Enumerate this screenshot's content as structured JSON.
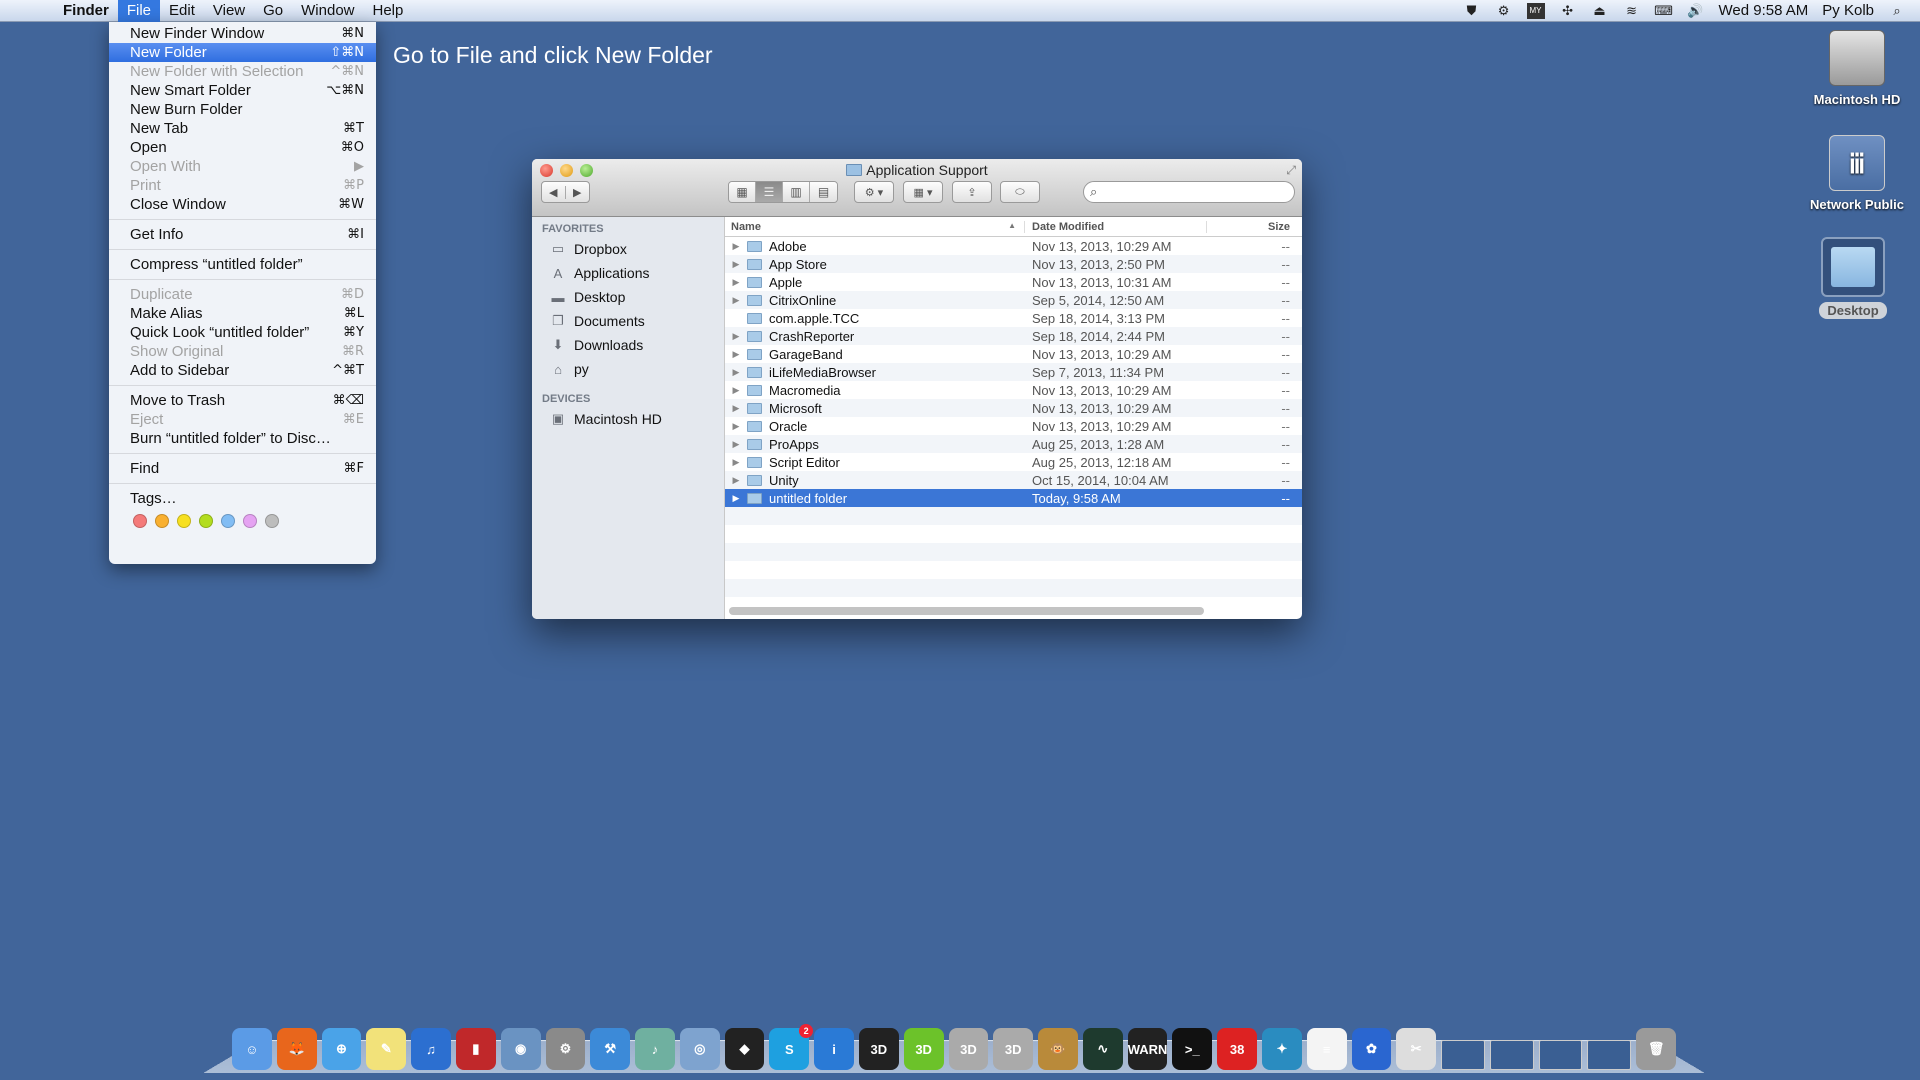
{
  "menubar": {
    "apple_icon": "apple-logo-icon",
    "app_name": "Finder",
    "menus": [
      "File",
      "Edit",
      "View",
      "Go",
      "Window",
      "Help"
    ],
    "active_menu": "File",
    "status_icons": [
      "vpn-shield-icon",
      "gear-badge-icon",
      "mypc-icon",
      "fan-icon",
      "eject-icon",
      "wifi-icon",
      "keyboard-icon",
      "volume-icon"
    ],
    "clock": "Wed 9:58 AM",
    "user": "Py Kolb",
    "spotlight_icon": "search-icon"
  },
  "file_menu": {
    "groups": [
      [
        {
          "label": "New Finder Window",
          "shortcut": "⌘N",
          "enabled": true
        },
        {
          "label": "New Folder",
          "shortcut": "⇧⌘N",
          "enabled": true,
          "highlighted": true
        },
        {
          "label": "New Folder with Selection",
          "shortcut": "^⌘N",
          "enabled": false
        },
        {
          "label": "New Smart Folder",
          "shortcut": "⌥⌘N",
          "enabled": true
        },
        {
          "label": "New Burn Folder",
          "shortcut": "",
          "enabled": true
        },
        {
          "label": "New Tab",
          "shortcut": "⌘T",
          "enabled": true
        },
        {
          "label": "Open",
          "shortcut": "⌘O",
          "enabled": true
        },
        {
          "label": "Open With",
          "shortcut": "▶",
          "enabled": false
        },
        {
          "label": "Print",
          "shortcut": "⌘P",
          "enabled": false
        },
        {
          "label": "Close Window",
          "shortcut": "⌘W",
          "enabled": true
        }
      ],
      [
        {
          "label": "Get Info",
          "shortcut": "⌘I",
          "enabled": true
        }
      ],
      [
        {
          "label": "Compress “untitled folder”",
          "shortcut": "",
          "enabled": true
        }
      ],
      [
        {
          "label": "Duplicate",
          "shortcut": "⌘D",
          "enabled": false
        },
        {
          "label": "Make Alias",
          "shortcut": "⌘L",
          "enabled": true
        },
        {
          "label": "Quick Look “untitled folder”",
          "shortcut": "⌘Y",
          "enabled": true
        },
        {
          "label": "Show Original",
          "shortcut": "⌘R",
          "enabled": false
        },
        {
          "label": "Add to Sidebar",
          "shortcut": "^⌘T",
          "enabled": true
        }
      ],
      [
        {
          "label": "Move to Trash",
          "shortcut": "⌘⌫",
          "enabled": true
        },
        {
          "label": "Eject",
          "shortcut": "⌘E",
          "enabled": false
        },
        {
          "label": "Burn “untitled folder” to Disc…",
          "shortcut": "",
          "enabled": true
        }
      ],
      [
        {
          "label": "Find",
          "shortcut": "⌘F",
          "enabled": true
        }
      ],
      [
        {
          "label": "Tags…",
          "shortcut": "",
          "enabled": true
        }
      ]
    ],
    "tag_colors": [
      "#f47a7a",
      "#f9b031",
      "#f7e021",
      "#b3dd1f",
      "#82bdf4",
      "#e5a3f2",
      "#bdbdbd"
    ]
  },
  "instruction": "Go to File and click New Folder",
  "finder": {
    "title": "Application Support",
    "toolbar": {
      "nav": [
        "◀",
        "▶"
      ],
      "view_modes": [
        "icon-view",
        "list-view",
        "column-view",
        "coverflow-view"
      ],
      "active_view": 1,
      "action_label": "⚙ ▾",
      "arrange_label": "▦ ▾",
      "share_label": "⇪",
      "tags_label": "⬭",
      "search_placeholder": ""
    },
    "sidebar": {
      "favorites_header": "FAVORITES",
      "favorites": [
        {
          "label": "Dropbox",
          "icon": "folder-icon"
        },
        {
          "label": "Applications",
          "icon": "applications-icon"
        },
        {
          "label": "Desktop",
          "icon": "desktop-icon"
        },
        {
          "label": "Documents",
          "icon": "documents-icon"
        },
        {
          "label": "Downloads",
          "icon": "downloads-icon"
        },
        {
          "label": "py",
          "icon": "home-icon"
        }
      ],
      "devices_header": "DEVICES",
      "devices": [
        {
          "label": "Macintosh HD",
          "icon": "hard-drive-icon"
        }
      ]
    },
    "columns": {
      "name": "Name",
      "date": "Date Modified",
      "size": "Size",
      "sort_indicator": "▲"
    },
    "rows": [
      {
        "name": "Adobe",
        "date": "Nov 13, 2013, 10:29 AM",
        "size": "--",
        "expandable": true
      },
      {
        "name": "App Store",
        "date": "Nov 13, 2013, 2:50 PM",
        "size": "--",
        "expandable": true
      },
      {
        "name": "Apple",
        "date": "Nov 13, 2013, 10:31 AM",
        "size": "--",
        "expandable": true
      },
      {
        "name": "CitrixOnline",
        "date": "Sep 5, 2014, 12:50 AM",
        "size": "--",
        "expandable": true
      },
      {
        "name": "com.apple.TCC",
        "date": "Sep 18, 2014, 3:13 PM",
        "size": "--",
        "expandable": false
      },
      {
        "name": "CrashReporter",
        "date": "Sep 18, 2014, 2:44 PM",
        "size": "--",
        "expandable": true
      },
      {
        "name": "GarageBand",
        "date": "Nov 13, 2013, 10:29 AM",
        "size": "--",
        "expandable": true
      },
      {
        "name": "iLifeMediaBrowser",
        "date": "Sep 7, 2013, 11:34 PM",
        "size": "--",
        "expandable": true
      },
      {
        "name": "Macromedia",
        "date": "Nov 13, 2013, 10:29 AM",
        "size": "--",
        "expandable": true
      },
      {
        "name": "Microsoft",
        "date": "Nov 13, 2013, 10:29 AM",
        "size": "--",
        "expandable": true
      },
      {
        "name": "Oracle",
        "date": "Nov 13, 2013, 10:29 AM",
        "size": "--",
        "expandable": true
      },
      {
        "name": "ProApps",
        "date": "Aug 25, 2013, 1:28 AM",
        "size": "--",
        "expandable": true
      },
      {
        "name": "Script Editor",
        "date": "Aug 25, 2013, 12:18 AM",
        "size": "--",
        "expandable": true
      },
      {
        "name": "Unity",
        "date": "Oct 15, 2014, 10:04 AM",
        "size": "--",
        "expandable": true
      },
      {
        "name": "untitled folder",
        "date": "Today, 9:58 AM",
        "size": "--",
        "expandable": true,
        "selected": true
      }
    ]
  },
  "desktop_icons": [
    {
      "label": "Macintosh HD",
      "icon": "hard-drive-icon"
    },
    {
      "label": "Network Public",
      "icon": "network-drive-icon"
    },
    {
      "label": "Desktop",
      "icon": "folder-icon",
      "selected": true
    }
  ],
  "dock": [
    {
      "name": "finder",
      "glyph": "☺",
      "color": "#5b9be6"
    },
    {
      "name": "firefox",
      "glyph": "🦊",
      "color": "#e8661c"
    },
    {
      "name": "safari",
      "glyph": "⊕",
      "color": "#4aa3e8"
    },
    {
      "name": "stickies",
      "glyph": "✎",
      "color": "#f2e27a"
    },
    {
      "name": "itunes",
      "glyph": "♫",
      "color": "#2c6fd0"
    },
    {
      "name": "photo-booth",
      "glyph": "▮",
      "color": "#c0282a"
    },
    {
      "name": "iphoto",
      "glyph": "◉",
      "color": "#6a93c2"
    },
    {
      "name": "system-preferences",
      "glyph": "⚙",
      "color": "#8a8a8a"
    },
    {
      "name": "xcode",
      "glyph": "⚒",
      "color": "#3c8ad8"
    },
    {
      "name": "midi-app",
      "glyph": "♪",
      "color": "#6fb0a0"
    },
    {
      "name": "unity-remote",
      "glyph": "◎",
      "color": "#7ea3cf"
    },
    {
      "name": "unity",
      "glyph": "◆",
      "color": "#222"
    },
    {
      "name": "skype",
      "glyph": "S",
      "color": "#1ea0e0",
      "badge": "2"
    },
    {
      "name": "info",
      "glyph": "i",
      "color": "#2a7ad6"
    },
    {
      "name": "3d-app",
      "glyph": "3D",
      "color": "#222"
    },
    {
      "name": "3d-app-5",
      "glyph": "3D",
      "color": "#6cc22a"
    },
    {
      "name": "3d-app-6",
      "glyph": "3D",
      "color": "#aaa"
    },
    {
      "name": "3d-app-7",
      "glyph": "3D",
      "color": "#aaa"
    },
    {
      "name": "monkey",
      "glyph": "🐵",
      "color": "#b98a3a"
    },
    {
      "name": "activity-monitor",
      "glyph": "∿",
      "color": "#1e3a2e"
    },
    {
      "name": "console",
      "glyph": "WARN",
      "color": "#222"
    },
    {
      "name": "terminal",
      "glyph": ">_",
      "color": "#111"
    },
    {
      "name": "3d-app-8",
      "glyph": "38",
      "color": "#d22"
    },
    {
      "name": "sourcetree",
      "glyph": "✦",
      "color": "#2a8cc0"
    },
    {
      "name": "textedit-doc",
      "glyph": "≡",
      "color": "#f4f4f4"
    },
    {
      "name": "settings-gear",
      "glyph": "✿",
      "color": "#2a66d0"
    },
    {
      "name": "grab",
      "glyph": "✂",
      "color": "#ddd"
    },
    {
      "name": "minimized-window-1",
      "glyph": "",
      "color": "#3a5f93"
    },
    {
      "name": "minimized-window-2",
      "glyph": "",
      "color": "#3a5f93"
    },
    {
      "name": "minimized-window-3",
      "glyph": "",
      "color": "#3a5f93"
    },
    {
      "name": "minimized-window-4",
      "glyph": "",
      "color": "#3a5f93"
    },
    {
      "name": "trash",
      "glyph": "🗑",
      "color": "#9a9a9a"
    }
  ]
}
